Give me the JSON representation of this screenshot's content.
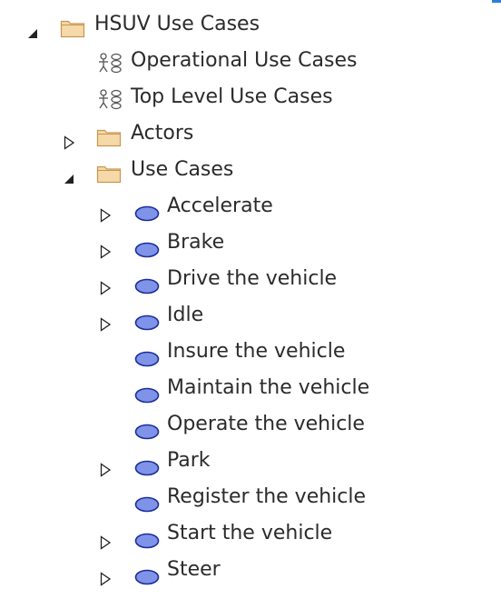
{
  "tree": {
    "root": {
      "label": "HSUV Use Cases",
      "icon": "folder-icon",
      "expanded": true
    },
    "level1": [
      {
        "label": "Operational Use Cases",
        "icon": "use-case-diagram-icon",
        "expander": "none"
      },
      {
        "label": "Top Level Use Cases",
        "icon": "use-case-diagram-icon",
        "expander": "none"
      },
      {
        "label": "Actors",
        "icon": "folder-icon",
        "expander": "collapsed"
      },
      {
        "label": "Use Cases",
        "icon": "folder-icon",
        "expander": "expanded"
      }
    ],
    "use_cases": [
      {
        "label": "Accelerate",
        "icon": "use-case-icon",
        "expander": "collapsed"
      },
      {
        "label": "Brake",
        "icon": "use-case-icon",
        "expander": "collapsed"
      },
      {
        "label": "Drive the vehicle",
        "icon": "use-case-icon",
        "expander": "collapsed"
      },
      {
        "label": "Idle",
        "icon": "use-case-icon",
        "expander": "collapsed"
      },
      {
        "label": "Insure the vehicle",
        "icon": "use-case-icon",
        "expander": "none"
      },
      {
        "label": "Maintain the vehicle",
        "icon": "use-case-icon",
        "expander": "none"
      },
      {
        "label": "Operate the vehicle",
        "icon": "use-case-icon",
        "expander": "none"
      },
      {
        "label": "Park",
        "icon": "use-case-icon",
        "expander": "collapsed"
      },
      {
        "label": "Register the vehicle",
        "icon": "use-case-icon",
        "expander": "none"
      },
      {
        "label": "Start the vehicle",
        "icon": "use-case-icon",
        "expander": "collapsed"
      },
      {
        "label": "Steer",
        "icon": "use-case-icon",
        "expander": "collapsed"
      }
    ]
  },
  "colors": {
    "folder_fill": "#f5d9a8",
    "folder_stroke": "#c9964f",
    "use_case_fill": "#7f93e8",
    "use_case_stroke": "#1c2d9a",
    "text": "#2b2b2b",
    "accent": "#2f7fd6"
  }
}
